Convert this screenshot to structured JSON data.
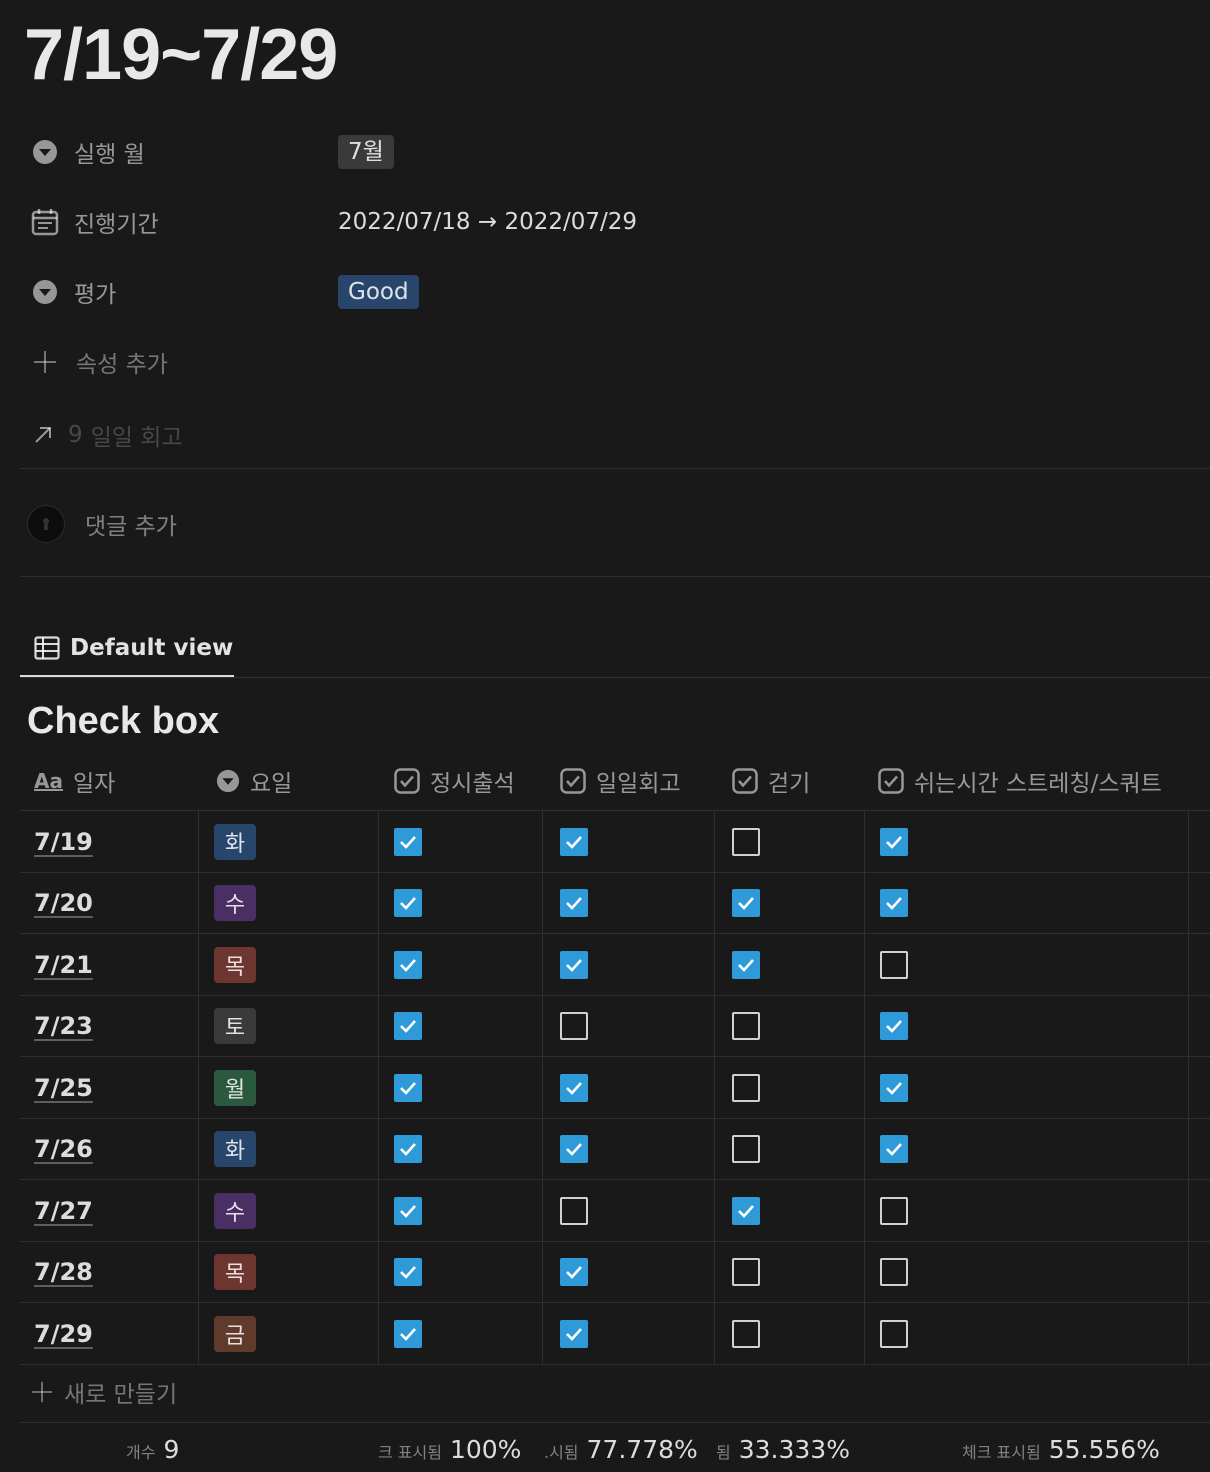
{
  "page": {
    "title": "7/19~7/29"
  },
  "properties": {
    "month": {
      "name": "실행 월",
      "value": "7월",
      "icon": "select-icon"
    },
    "period": {
      "name": "진행기간",
      "value": "2022/07/18 → 2022/07/29",
      "icon": "calendar-icon"
    },
    "rating": {
      "name": "평가",
      "value": "Good",
      "icon": "select-icon"
    },
    "add_property": "속성 추가",
    "relation": {
      "count": "9",
      "label": "일일 회고",
      "icon": "arrow-up-right-icon"
    }
  },
  "comments": {
    "add_label": "댓글 추가"
  },
  "view": {
    "tab_label": "Default view",
    "icon": "table-icon"
  },
  "database": {
    "title": "Check box",
    "columns": [
      {
        "name": "일자",
        "icon": "Aa"
      },
      {
        "name": "요일",
        "icon": "select-icon"
      },
      {
        "name": "정시출석",
        "icon": "checkbox-icon"
      },
      {
        "name": "일일회고",
        "icon": "checkbox-icon"
      },
      {
        "name": "걷기",
        "icon": "checkbox-icon"
      },
      {
        "name": "쉬는시간 스트레칭/스쿼트",
        "icon": "checkbox-icon"
      }
    ],
    "rows": [
      {
        "date": "7/19",
        "day": "화",
        "day_color": "blue",
        "checks": [
          true,
          true,
          false,
          true
        ]
      },
      {
        "date": "7/20",
        "day": "수",
        "day_color": "purple",
        "checks": [
          true,
          true,
          true,
          true
        ]
      },
      {
        "date": "7/21",
        "day": "목",
        "day_color": "red",
        "checks": [
          true,
          true,
          true,
          false
        ]
      },
      {
        "date": "7/23",
        "day": "토",
        "day_color": "gray",
        "checks": [
          true,
          false,
          false,
          true
        ]
      },
      {
        "date": "7/25",
        "day": "월",
        "day_color": "green",
        "checks": [
          true,
          true,
          false,
          true
        ]
      },
      {
        "date": "7/26",
        "day": "화",
        "day_color": "blue",
        "checks": [
          true,
          true,
          false,
          true
        ]
      },
      {
        "date": "7/27",
        "day": "수",
        "day_color": "purple",
        "checks": [
          true,
          false,
          true,
          false
        ]
      },
      {
        "date": "7/28",
        "day": "목",
        "day_color": "red",
        "checks": [
          true,
          true,
          false,
          false
        ]
      },
      {
        "date": "7/29",
        "day": "금",
        "day_color": "brown",
        "checks": [
          true,
          true,
          false,
          false
        ]
      }
    ],
    "new_label": "새로 만들기",
    "footer": [
      {
        "label": "개수",
        "value": "9"
      },
      {
        "label": "크 표시됨",
        "value": "100%"
      },
      {
        "label": ".시됨",
        "value": "77.778%"
      },
      {
        "label": "됨",
        "value": "33.333%"
      },
      {
        "label": "체크 표시됨",
        "value": "55.556%"
      }
    ]
  },
  "colors": {
    "background": "#191919",
    "checkbox_on": "#2e9bd8",
    "tag_gray": "#3a3a3a",
    "tag_blue": "#28456c",
    "tag_purple": "#492f64",
    "tag_red": "#6e3630",
    "tag_green": "#2b593f",
    "tag_brown": "#603b2c"
  }
}
